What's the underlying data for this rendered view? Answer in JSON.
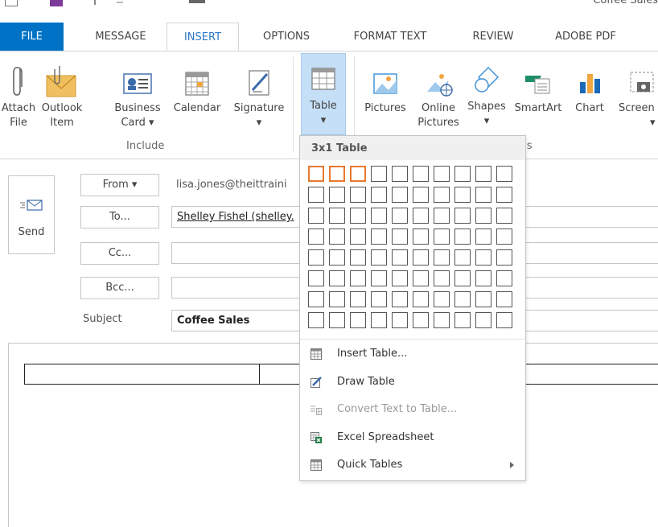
{
  "window": {
    "title": "Coffee Sales"
  },
  "tabs": [
    "FILE",
    "MESSAGE",
    "INSERT",
    "OPTIONS",
    "FORMAT TEXT",
    "REVIEW",
    "ADOBE PDF"
  ],
  "ribbon": {
    "attach_file": [
      "Attach",
      "File"
    ],
    "outlook_item": [
      "Outlook",
      "Item"
    ],
    "business_card": [
      "Business",
      "Card ▾"
    ],
    "calendar": "Calendar",
    "signature": "Signature",
    "table": "Table",
    "pictures": "Pictures",
    "online_pictures": [
      "Online",
      "Pictures"
    ],
    "shapes": "Shapes",
    "smartart": "SmartArt",
    "chart": "Chart",
    "screenshot": "Screen",
    "group_include": "Include",
    "group_illustrations_partial": "ations",
    "dropdown_caret": "▾"
  },
  "compose": {
    "send_label": "Send",
    "from_label": "From ▾",
    "from_value": "lisa.jones@theittraini",
    "to_label": "To...",
    "to_value": "Shelley Fishel (shelley.",
    "cc_label": "Cc...",
    "bcc_label": "Bcc...",
    "subject_label": "Subject",
    "subject_value": "Coffee Sales"
  },
  "table_dropdown": {
    "header": "3x1 Table",
    "grid_columns": 10,
    "grid_rows": 8,
    "selected_columns": 3,
    "selected_rows": 1,
    "items": [
      {
        "label": "Insert Table...",
        "icon": "table-grid-icon",
        "enabled": true
      },
      {
        "label": "Draw Table",
        "icon": "draw-table-pencil-icon",
        "enabled": true
      },
      {
        "label": "Convert Text to Table...",
        "icon": "convert-text-icon",
        "enabled": false
      },
      {
        "label": "Excel Spreadsheet",
        "icon": "excel-icon",
        "enabled": true
      },
      {
        "label": "Quick Tables",
        "icon": "quick-tables-icon",
        "enabled": true,
        "submenu": true
      }
    ]
  },
  "colors": {
    "file_tab": "#0072c6",
    "active_tab_text": "#2b78c5",
    "table_highlight": "#c5dff7",
    "selected_cell": "#e8792f"
  }
}
